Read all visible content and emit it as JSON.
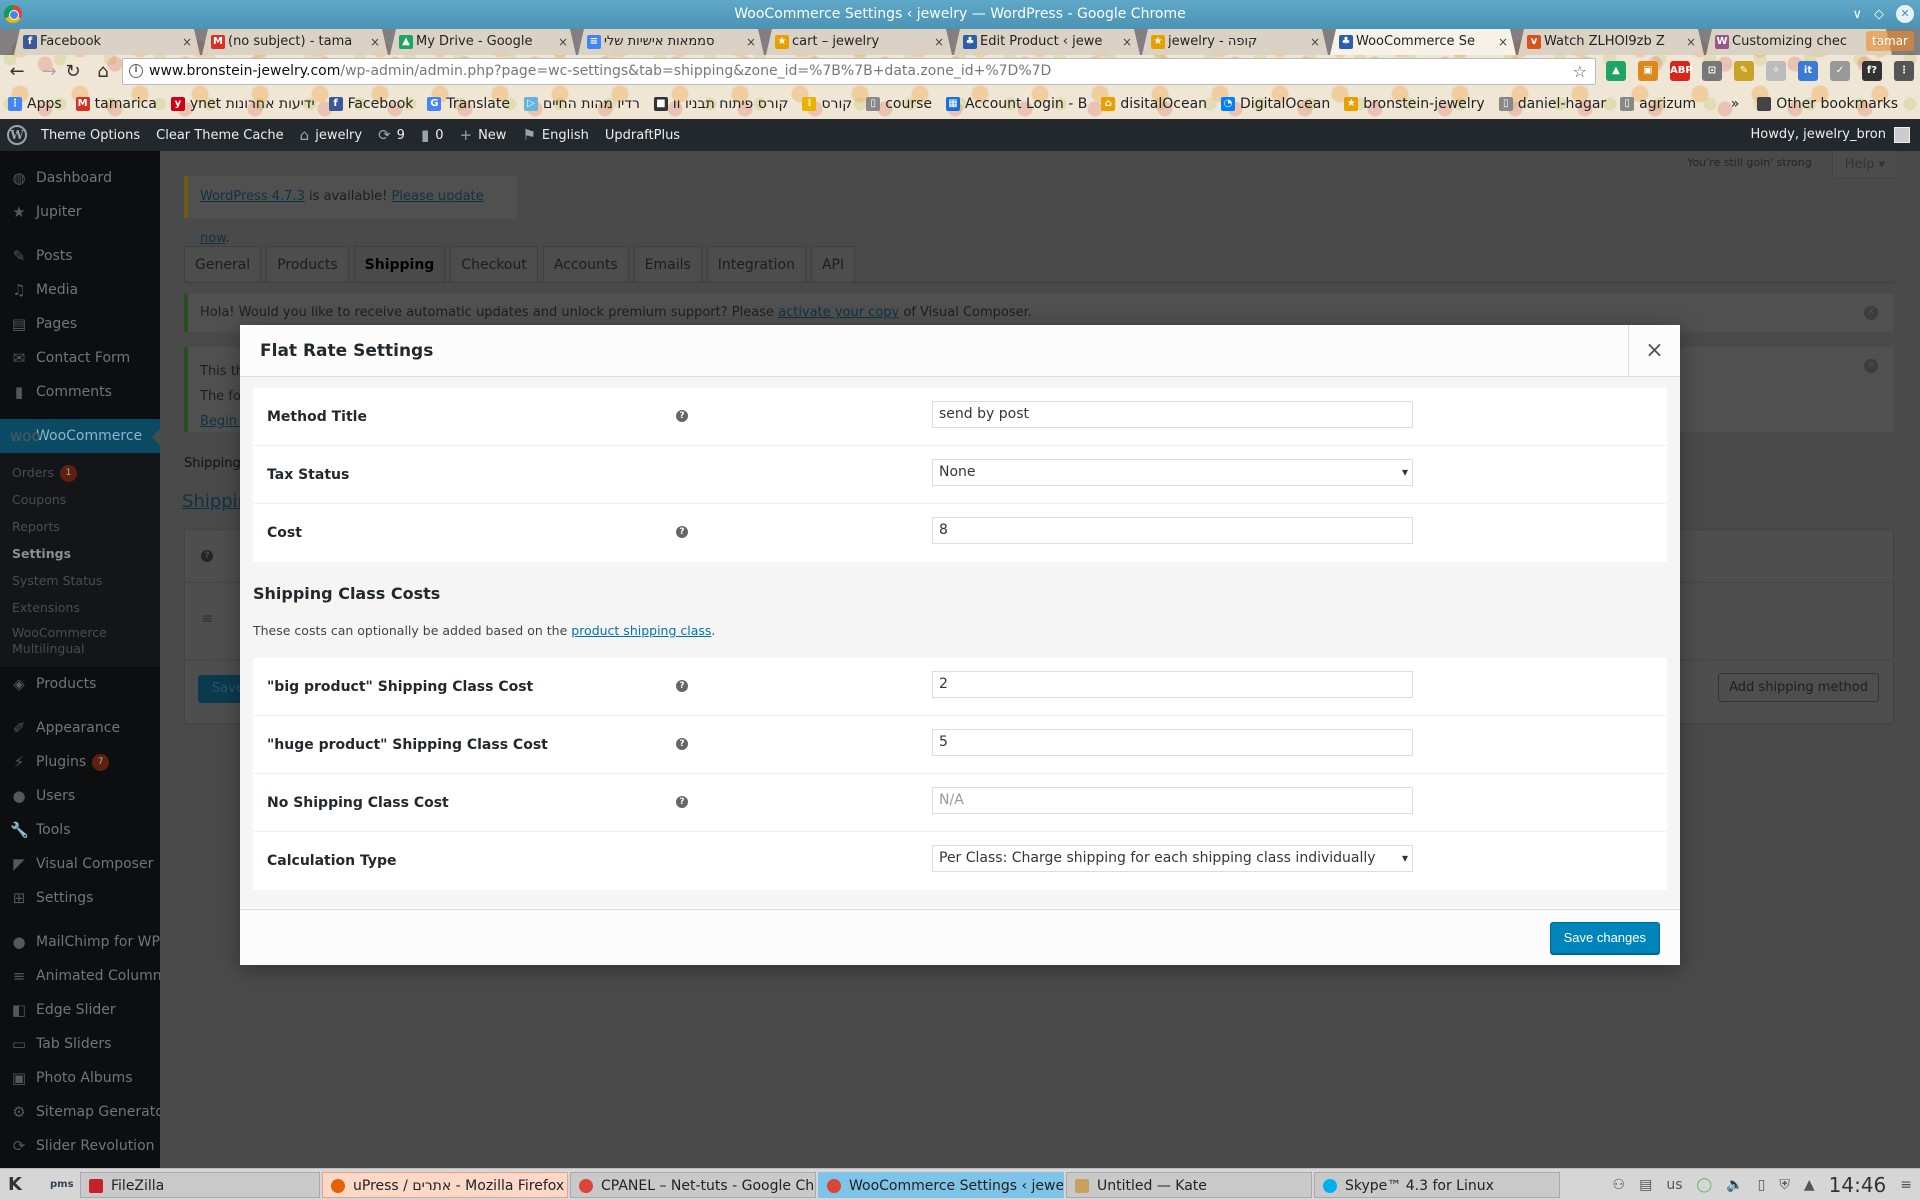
{
  "window": {
    "title": "WooCommerce Settings ‹ jewelry — WordPress - Google Chrome",
    "controls": [
      "minimize",
      "maximize",
      "close"
    ]
  },
  "browser": {
    "tabs": [
      {
        "label": "Facebook",
        "icon": "facebook-icon",
        "color": "#3b5998",
        "glyph": "f",
        "active": false
      },
      {
        "label": "(no subject) - tama",
        "icon": "gmail-icon",
        "color": "#d93025",
        "glyph": "M",
        "active": false
      },
      {
        "label": "My Drive - Google",
        "icon": "google-drive-icon",
        "color": "#1fa463",
        "glyph": "▲",
        "active": false
      },
      {
        "label": "סממאות אישיות שלי",
        "icon": "google-docs-icon",
        "color": "#4285f4",
        "glyph": "≡",
        "active": false
      },
      {
        "label": "cart – jewelry",
        "icon": "star-icon",
        "color": "#e8a000",
        "glyph": "★",
        "active": false
      },
      {
        "label": "Edit Product ‹ jewe",
        "icon": "woocommerce-icon",
        "color": "#2b5fa8",
        "glyph": "♣",
        "active": false
      },
      {
        "label": "jewelry - קופה",
        "icon": "star-icon",
        "color": "#e8a000",
        "glyph": "★",
        "active": false
      },
      {
        "label": "WooCommerce Se",
        "icon": "woocommerce-icon",
        "color": "#2b5fa8",
        "glyph": "♣",
        "active": true
      },
      {
        "label": "Watch ZLHOl9zb Z",
        "icon": "video-icon",
        "color": "#d9531e",
        "glyph": "v",
        "active": false
      },
      {
        "label": "Customizing chec",
        "icon": "woo-docs-icon",
        "color": "#96588a",
        "glyph": "W",
        "active": false
      }
    ],
    "profile_label": "tamar",
    "url": {
      "host": "www.bronstein-jewelry.com",
      "path": "/wp-admin/admin.php?page=wc-settings&tab=shipping&zone_id=%7B%7B+data.zone_id+%7D%7D"
    },
    "extensions": [
      {
        "name": "google-drive-ext-icon",
        "color": "#1fa463",
        "glyph": "▲"
      },
      {
        "name": "ext-orange-icon",
        "color": "#d98a1a",
        "glyph": "▣"
      },
      {
        "name": "adblock-plus-icon",
        "color": "#d9261c",
        "glyph": "ABP"
      },
      {
        "name": "cast-icon",
        "color": "#777777",
        "glyph": "⊡"
      },
      {
        "name": "color-picker-icon",
        "color": "#c9a227",
        "glyph": "✎"
      },
      {
        "name": "kangaroo-icon",
        "color": "#bbbbbb",
        "glyph": "✧"
      },
      {
        "name": "instapaper-icon",
        "color": "#3a7bd5",
        "glyph": "it"
      },
      {
        "name": "pocket-icon",
        "color": "#999999",
        "glyph": "✓"
      },
      {
        "name": "font-finder-icon",
        "color": "#333333",
        "glyph": "f?"
      },
      {
        "name": "chrome-menu-icon",
        "color": "#555555",
        "glyph": "⋮"
      }
    ],
    "bookmarks": [
      {
        "label": "Apps",
        "icon": "apps-grid-icon",
        "color": "#4285f4",
        "glyph": "⋮"
      },
      {
        "label": "tamarica",
        "icon": "gmail-icon",
        "color": "#d93025",
        "glyph": "M"
      },
      {
        "label": "ynet ידיעות אחרונות",
        "icon": "ynet-icon",
        "color": "#d0021b",
        "glyph": "y"
      },
      {
        "label": "Facebook",
        "icon": "facebook-icon",
        "color": "#3b5998",
        "glyph": "f"
      },
      {
        "label": "Translate",
        "icon": "translate-icon",
        "color": "#4285f4",
        "glyph": "G"
      },
      {
        "label": "רדיו מהות החיים",
        "icon": "play-icon",
        "color": "#66b3e0",
        "glyph": "▷"
      },
      {
        "label": "קורס פיתוח תבניו וו",
        "icon": "folder-icon",
        "color": "#333333",
        "glyph": "■"
      },
      {
        "label": "קורס",
        "icon": "grid-icon",
        "color": "#e8b400",
        "glyph": "⁞"
      },
      {
        "label": "course",
        "icon": "page-icon",
        "color": "#888888",
        "glyph": "▯"
      },
      {
        "label": "Account Login - B",
        "icon": "grid-icon",
        "color": "#1a6fd6",
        "glyph": "▦"
      },
      {
        "label": "disitalOcean",
        "icon": "pma-icon",
        "color": "#e8a000",
        "glyph": "⌂"
      },
      {
        "label": "DigitalOcean",
        "icon": "digitalocean-icon",
        "color": "#0080ff",
        "glyph": "◔"
      },
      {
        "label": "bronstein-jewelry",
        "icon": "star-icon",
        "color": "#e8a000",
        "glyph": "★"
      },
      {
        "label": "daniel-hagar",
        "icon": "page-icon",
        "color": "#888888",
        "glyph": "▯"
      },
      {
        "label": "agrizum",
        "icon": "page-icon",
        "color": "#888888",
        "glyph": "▯"
      }
    ],
    "more_bookmarks": "»",
    "other_bookmarks": "Other bookmarks"
  },
  "adminbar": {
    "items": [
      {
        "label": "Theme Options",
        "icon": ""
      },
      {
        "label": "Clear Theme Cache",
        "icon": ""
      },
      {
        "label": "jewelry",
        "icon": "home-icon",
        "glyph": "⌂"
      },
      {
        "label": "9",
        "icon": "updates-icon",
        "glyph": "⟳"
      },
      {
        "label": "0",
        "icon": "comments-icon",
        "glyph": "▮"
      },
      {
        "label": "New",
        "icon": "plus-icon",
        "glyph": "+"
      },
      {
        "label": "English",
        "icon": "uk-flag-icon",
        "glyph": "⚑"
      },
      {
        "label": "UpdraftPlus",
        "icon": ""
      }
    ],
    "howdy": "Howdy, jewelry_bron"
  },
  "sidebar": {
    "items_top": [
      {
        "label": "Dashboard",
        "icon": "dashboard-icon",
        "glyph": "◍"
      },
      {
        "label": "Jupiter",
        "icon": "star-icon",
        "glyph": "★"
      }
    ],
    "items_content": [
      {
        "label": "Posts",
        "icon": "pin-icon",
        "glyph": "✎"
      },
      {
        "label": "Media",
        "icon": "media-icon",
        "glyph": "♫"
      },
      {
        "label": "Pages",
        "icon": "pages-icon",
        "glyph": "▤"
      },
      {
        "label": "Contact Form",
        "icon": "contact-form-icon",
        "glyph": "✉"
      },
      {
        "label": "Comments",
        "icon": "comments-icon",
        "glyph": "▮"
      }
    ],
    "woocommerce": {
      "label": "WooCommerce",
      "icon": "woocommerce-icon",
      "glyph": "woo",
      "submenu": [
        {
          "label": "Orders",
          "badge": "1",
          "current": false
        },
        {
          "label": "Coupons",
          "current": false
        },
        {
          "label": "Reports",
          "current": false
        },
        {
          "label": "Settings",
          "current": true
        },
        {
          "label": "System Status",
          "current": false
        },
        {
          "label": "Extensions",
          "current": false
        },
        {
          "label": "WooCommerce Multilingual",
          "current": false
        }
      ]
    },
    "items_after": [
      {
        "label": "Products",
        "icon": "products-icon",
        "glyph": "◈"
      },
      {
        "label": "Appearance",
        "icon": "appearance-icon",
        "glyph": "✐",
        "gap_before": true
      },
      {
        "label": "Plugins",
        "icon": "plugins-icon",
        "glyph": "⚡",
        "badge": "7"
      },
      {
        "label": "Users",
        "icon": "users-icon",
        "glyph": "●"
      },
      {
        "label": "Tools",
        "icon": "tools-icon",
        "glyph": "🔧"
      },
      {
        "label": "Visual Composer",
        "icon": "visual-composer-icon",
        "glyph": "◤"
      },
      {
        "label": "Settings",
        "icon": "settings-icon",
        "glyph": "⊞"
      },
      {
        "label": "MailChimp for WP",
        "icon": "mailchimp-icon",
        "glyph": "●",
        "gap_before": true
      },
      {
        "label": "Animated Columns",
        "icon": "animated-columns-icon",
        "glyph": "≡"
      },
      {
        "label": "Edge Slider",
        "icon": "edge-slider-icon",
        "glyph": "◧"
      },
      {
        "label": "Tab Sliders",
        "icon": "tab-sliders-icon",
        "glyph": "▭"
      },
      {
        "label": "Photo Albums",
        "icon": "photo-albums-icon",
        "glyph": "▣"
      },
      {
        "label": "Sitemap Generator",
        "icon": "gear-icon",
        "glyph": "⚙"
      },
      {
        "label": "Slider Revolution",
        "icon": "refresh-icon",
        "glyph": "⟳"
      }
    ]
  },
  "main": {
    "still_strong": "You're still goin' strong",
    "help_label": "Help ▾",
    "update_nag": {
      "link1": "WordPress 4.7.3",
      "middle": " is available! ",
      "link2": "Please update now",
      "end": "."
    },
    "settings_tabs": [
      {
        "label": "General",
        "active": false
      },
      {
        "label": "Products",
        "active": false
      },
      {
        "label": "Shipping",
        "active": true
      },
      {
        "label": "Checkout",
        "active": false
      },
      {
        "label": "Accounts",
        "active": false
      },
      {
        "label": "Emails",
        "active": false
      },
      {
        "label": "Integration",
        "active": false
      },
      {
        "label": "API",
        "active": false
      }
    ],
    "vc_notice": {
      "before": "Hola! Would you like to receive automatic updates and unlock premium support? Please ",
      "link": "activate your copy",
      "after": " of Visual Composer."
    },
    "theme_notice": {
      "line1": "This th",
      "line2": "The fol",
      "link": "Begin i"
    },
    "zone_crumb": "Shipping Z",
    "zone_link": "Shippin",
    "save_bg_label": "Save c",
    "add_method_label": "Add shipping method"
  },
  "modal": {
    "title": "Flat Rate Settings",
    "close_label": "×",
    "fields_top": [
      {
        "label": "Method Title",
        "type": "text",
        "value": "send by post",
        "placeholder": "",
        "has_help": true
      },
      {
        "label": "Tax Status",
        "type": "select",
        "value": "None",
        "has_help": false
      },
      {
        "label": "Cost",
        "type": "text",
        "value": "8",
        "placeholder": "",
        "has_help": true
      }
    ],
    "class_costs_heading": "Shipping Class Costs",
    "class_costs_desc_before": "These costs can optionally be added based on the ",
    "class_costs_desc_link": "product shipping class",
    "class_costs_desc_after": ".",
    "fields_classes": [
      {
        "label": "\"big product\" Shipping Class Cost",
        "type": "text",
        "value": "2",
        "placeholder": "",
        "has_help": true
      },
      {
        "label": "\"huge product\" Shipping Class Cost",
        "type": "text",
        "value": "5",
        "placeholder": "",
        "has_help": true
      },
      {
        "label": "No Shipping Class Cost",
        "type": "text",
        "value": "",
        "placeholder": "N/A",
        "has_help": true
      },
      {
        "label": "Calculation Type",
        "type": "select",
        "value": "Per Class: Charge shipping for each shipping class individually",
        "has_help": false
      }
    ],
    "save_label": "Save changes"
  },
  "taskbar": {
    "tasks": [
      {
        "label": "FileZilla",
        "icon": "filezilla-icon",
        "color": "#c8202a",
        "variant": ""
      },
      {
        "label": "uPress / אתרים - Mozilla Firefox",
        "icon": "firefox-icon",
        "color": "#e66000",
        "variant": "firefox"
      },
      {
        "label": "CPANEL – Net-tuts - Google Chro",
        "icon": "chrome-icon",
        "color": "#db4437",
        "variant": ""
      },
      {
        "label": "WooCommerce Settings ‹ jewelry -",
        "icon": "chrome-icon",
        "color": "#db4437",
        "variant": "active"
      },
      {
        "label": "Untitled — Kate",
        "icon": "kate-icon",
        "color": "#c8a060",
        "variant": ""
      },
      {
        "label": "Skype™ 4.3 for Linux",
        "icon": "skype-icon",
        "color": "#00aff0",
        "variant": ""
      }
    ],
    "keyboard_layout": "us",
    "clock": "14:46"
  },
  "colors": {
    "wp_primary": "#0085ba",
    "admin_bar": "#23282d",
    "link": "#0073aa"
  }
}
